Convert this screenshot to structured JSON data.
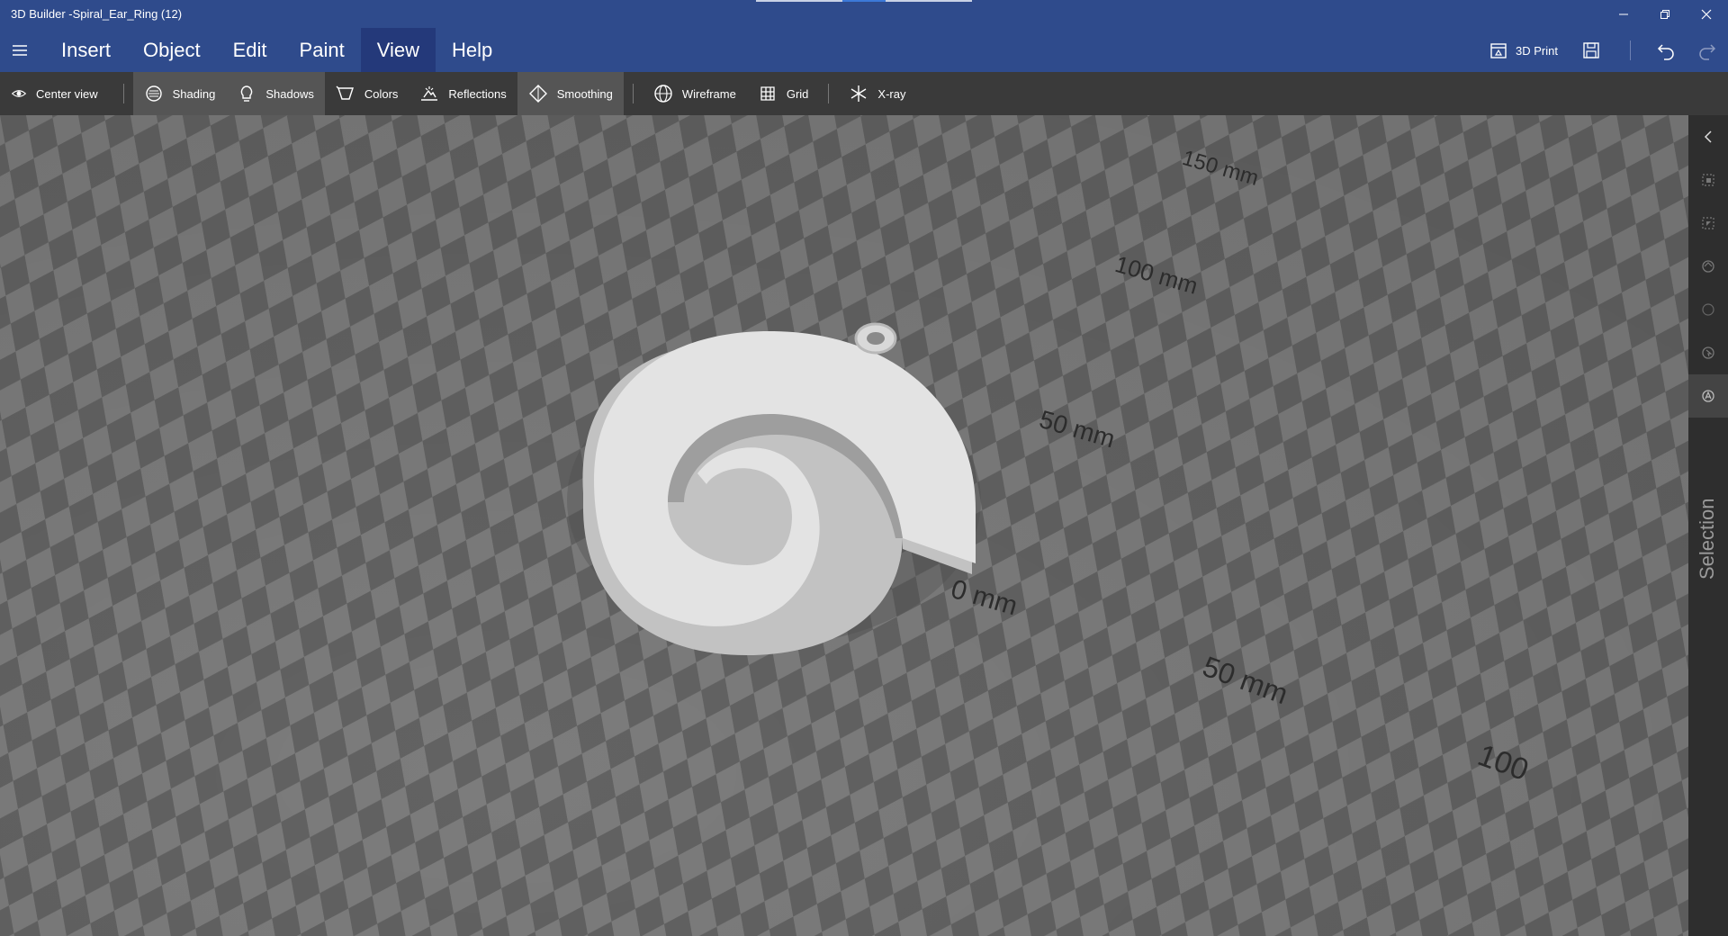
{
  "window": {
    "title": "3D Builder -Spiral_Ear_Ring (12)"
  },
  "menubar": {
    "items": [
      {
        "label": "Insert",
        "active": false
      },
      {
        "label": "Object",
        "active": false
      },
      {
        "label": "Edit",
        "active": false
      },
      {
        "label": "Paint",
        "active": false
      },
      {
        "label": "View",
        "active": true
      },
      {
        "label": "Help",
        "active": false
      }
    ],
    "print_label": "3D Print"
  },
  "toolbar": {
    "center_view": "Center view",
    "shading": "Shading",
    "shadows": "Shadows",
    "colors": "Colors",
    "reflections": "Reflections",
    "smoothing": "Smoothing",
    "wireframe": "Wireframe",
    "grid": "Grid",
    "xray": "X-ray"
  },
  "viewport": {
    "axis_labels": [
      "150 mm",
      "100 mm",
      "50 mm",
      "0 mm",
      "50 mm",
      "100"
    ],
    "model_color": "#e3e3e3",
    "grid_dark": "#626262",
    "grid_light": "#7c7c7c"
  },
  "sidepanel": {
    "label": "Selection"
  },
  "colors": {
    "title_bar": "#2f4b8c",
    "toolbar": "#3a3a3a",
    "side_panel": "#2e2e2e"
  }
}
